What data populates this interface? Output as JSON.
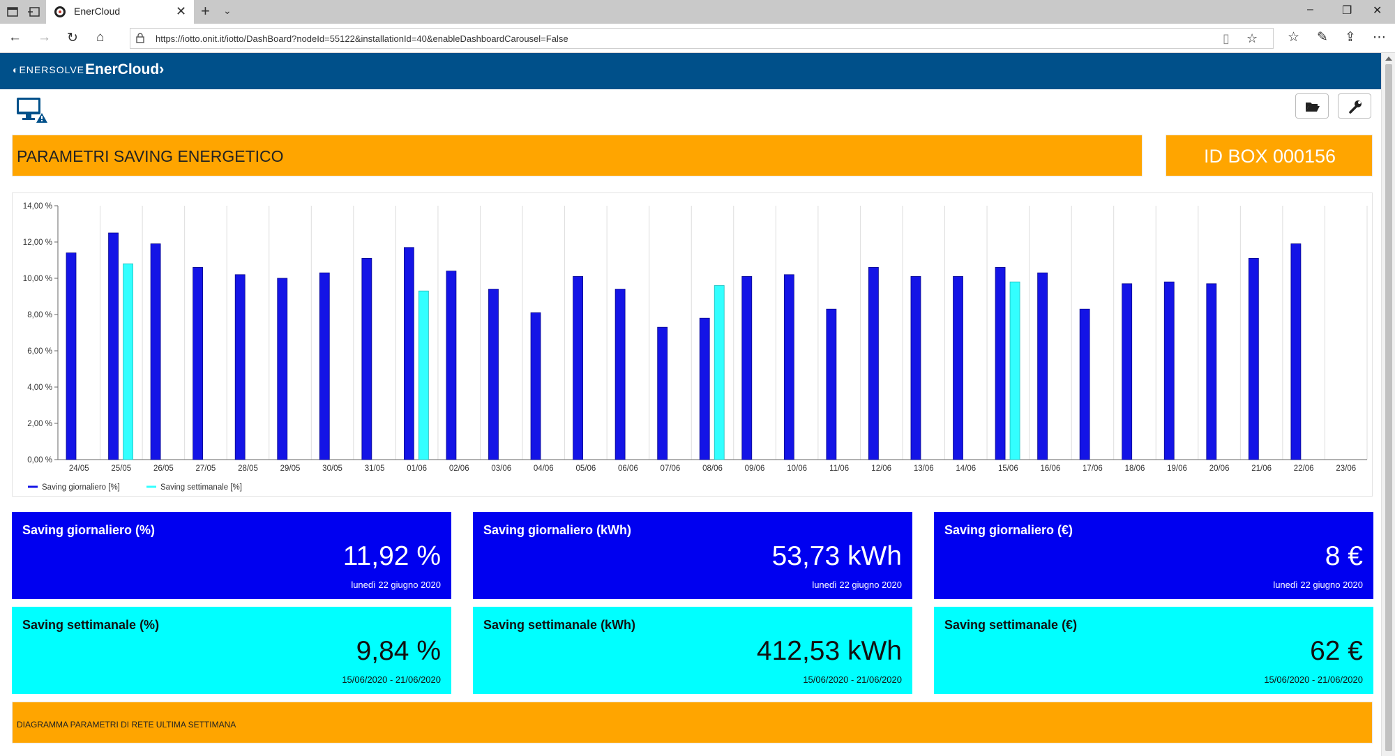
{
  "browser": {
    "tab_title": "EnerCloud",
    "tab_close": "✕",
    "new_tab": "+",
    "tab_list": "⌄",
    "url": "https://iotto.onit.it/iotto/DashBoard?nodeId=55122&installationId=40&enableDashboardCarousel=False",
    "window_minimize": "–",
    "window_restore": "❐",
    "window_close": "✕"
  },
  "header": {
    "logo": "ENERSOLVE",
    "brand": "EnerCloud",
    "chevron": "›"
  },
  "title": "PARAMETRI SAVING ENERGETICO",
  "id_box": "ID BOX 000156",
  "chart_data": {
    "type": "bar",
    "categories": [
      "24/05",
      "25/05",
      "26/05",
      "27/05",
      "28/05",
      "29/05",
      "30/05",
      "31/05",
      "01/06",
      "02/06",
      "03/06",
      "04/06",
      "05/06",
      "06/06",
      "07/06",
      "08/06",
      "09/06",
      "10/06",
      "11/06",
      "12/06",
      "13/06",
      "14/06",
      "15/06",
      "16/06",
      "17/06",
      "18/06",
      "19/06",
      "20/06",
      "21/06",
      "22/06",
      "23/06"
    ],
    "series": [
      {
        "name": "Saving giornaliero [%]",
        "color": "#1414e6",
        "values": [
          11.4,
          12.5,
          11.9,
          10.6,
          10.2,
          10.0,
          10.3,
          11.1,
          11.7,
          10.4,
          9.4,
          8.1,
          10.1,
          9.4,
          7.3,
          7.8,
          10.1,
          10.2,
          8.3,
          10.6,
          10.1,
          10.1,
          10.6,
          10.3,
          8.3,
          9.7,
          9.8,
          9.7,
          11.1,
          11.9,
          null
        ]
      },
      {
        "name": "Saving settimanale [%]",
        "color": "#33ffff",
        "values": [
          null,
          10.8,
          null,
          null,
          null,
          null,
          null,
          null,
          9.3,
          null,
          null,
          null,
          null,
          null,
          null,
          9.6,
          null,
          null,
          null,
          null,
          null,
          null,
          9.8,
          null,
          null,
          null,
          null,
          null,
          null,
          null,
          null
        ]
      }
    ],
    "ylim": [
      0,
      14
    ],
    "yticks": [
      "0,00 %",
      "2,00 %",
      "4,00 %",
      "6,00 %",
      "8,00 %",
      "10,00 %",
      "12,00 %",
      "14,00 %"
    ],
    "grid": "vertical",
    "legend_position": "bottom-left"
  },
  "cards": [
    {
      "title": "Saving giornaliero (%)",
      "value": "11,92 %",
      "date": "lunedì 22 giugno 2020"
    },
    {
      "title": "Saving giornaliero (kWh)",
      "value": "53,73 kWh",
      "date": "lunedì 22 giugno 2020"
    },
    {
      "title": "Saving giornaliero (€)",
      "value": "8 €",
      "date": "lunedì 22 giugno 2020"
    },
    {
      "title": "Saving settimanale (%)",
      "value": "9,84 %",
      "date": "15/06/2020 - 21/06/2020"
    },
    {
      "title": "Saving settimanale (kWh)",
      "value": "412,53 kWh",
      "date": "15/06/2020 - 21/06/2020"
    },
    {
      "title": "Saving settimanale (€)",
      "value": "62 €",
      "date": "15/06/2020 - 21/06/2020"
    }
  ],
  "bottom_title": "DIAGRAMMA PARAMETRI DI RETE ULTIMA SETTIMANA"
}
